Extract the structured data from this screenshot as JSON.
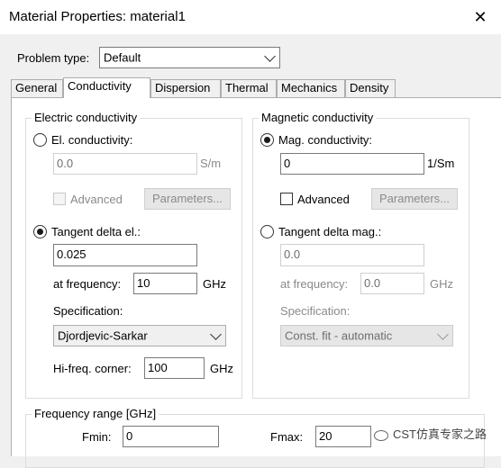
{
  "window": {
    "title": "Material Properties: material1",
    "close_glyph": "✕"
  },
  "problem_type": {
    "label": "Problem type:",
    "value": "Default"
  },
  "tabs": [
    {
      "label": "General"
    },
    {
      "label": "Conductivity"
    },
    {
      "label": "Dispersion"
    },
    {
      "label": "Thermal"
    },
    {
      "label": "Mechanics"
    },
    {
      "label": "Density"
    }
  ],
  "electric": {
    "group_title": "Electric conductivity",
    "el_conductivity_label": "El. conductivity:",
    "el_conductivity_value": "0.0",
    "el_conductivity_unit": "S/m",
    "advanced_label": "Advanced",
    "parameters_label": "Parameters...",
    "tangent_label": "Tangent delta el.:",
    "tangent_value": "0.025",
    "frequency_label": "at frequency:",
    "frequency_value": "10",
    "frequency_unit": "GHz",
    "specification_label": "Specification:",
    "specification_value": "Djordjevic-Sarkar",
    "hifreq_label": "Hi-freq. corner:",
    "hifreq_value": "100",
    "hifreq_unit": "GHz"
  },
  "magnetic": {
    "group_title": "Magnetic conductivity",
    "mag_conductivity_label": "Mag. conductivity:",
    "mag_conductivity_value": "0",
    "mag_conductivity_unit": "1/Sm",
    "advanced_label": "Advanced",
    "parameters_label": "Parameters...",
    "tangent_label": "Tangent delta mag.:",
    "tangent_value": "0.0",
    "frequency_label": "at frequency:",
    "frequency_value": "0.0",
    "frequency_unit": "GHz",
    "specification_label": "Specification:",
    "specification_value": "Const. fit - automatic"
  },
  "frequency_range": {
    "group_title": "Frequency range [GHz]",
    "fmin_label": "Fmin:",
    "fmin_value": "0",
    "fmax_label": "Fmax:",
    "fmax_value": "20"
  },
  "watermark": {
    "text": "CST仿真专家之路"
  }
}
